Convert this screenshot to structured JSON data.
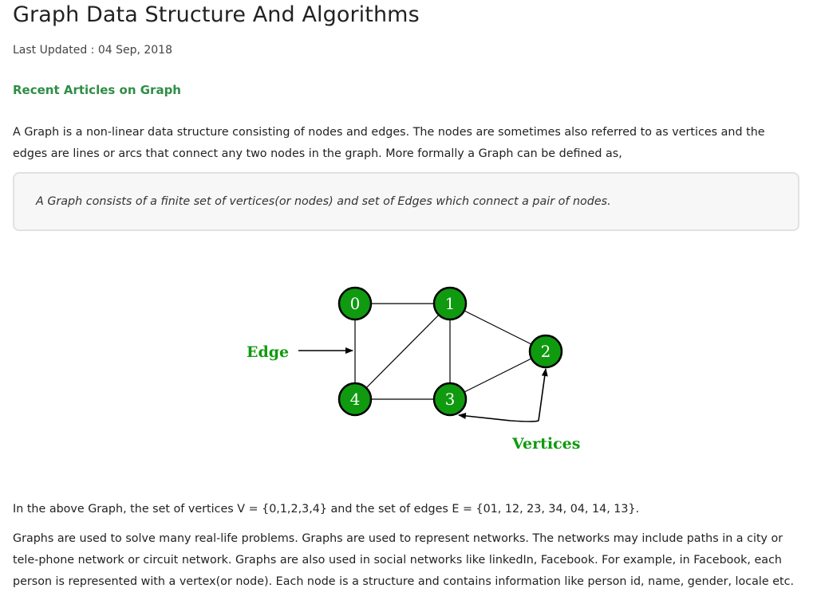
{
  "article": {
    "title": "Graph Data Structure And Algorithms",
    "last_updated": "Last Updated : 04 Sep, 2018",
    "recent_link": "Recent Articles on Graph",
    "intro": "A Graph is a non-linear data structure consisting of nodes and edges. The nodes are sometimes also referred to as vertices and the edges are lines or arcs that connect any two nodes in the graph. More formally a Graph can be defined as,",
    "definition": "A Graph consists of a finite set of vertices(or nodes) and set of Edges which connect a pair of nodes.",
    "sets_text": "In the above Graph, the set of vertices V = {0,1,2,3,4} and the set of edges E = {01, 12, 23, 34, 04, 14, 13}.",
    "uses_text": "Graphs are used to solve many real-life problems. Graphs are used to represent networks. The networks may include paths in a city or tele-phone network or circuit network. Graphs are also used in social networks like linkedIn, Facebook. For example, in Facebook, each person is represented with a vertex(or node). Each node is a structure and contains information like person id, name, gender, locale etc."
  },
  "diagram": {
    "nodes": [
      {
        "id": "0"
      },
      {
        "id": "1"
      },
      {
        "id": "2"
      },
      {
        "id": "3"
      },
      {
        "id": "4"
      }
    ],
    "edges": [
      [
        "0",
        "1"
      ],
      [
        "1",
        "2"
      ],
      [
        "2",
        "3"
      ],
      [
        "3",
        "4"
      ],
      [
        "0",
        "4"
      ],
      [
        "1",
        "4"
      ],
      [
        "1",
        "3"
      ]
    ],
    "edge_label": "Edge",
    "vertices_label": "Vertices",
    "node_color": "#0f9a0f",
    "label_color": "#0f9a0f"
  },
  "colors": {
    "link_green": "#2f8d46",
    "quote_background": "#f7f7f7"
  }
}
